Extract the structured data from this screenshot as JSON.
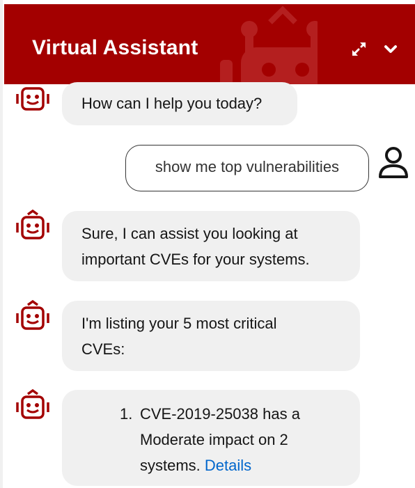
{
  "header": {
    "title": "Virtual Assistant",
    "icons": [
      "robot-icon",
      "expand-icon",
      "chevron-down-icon"
    ],
    "bg_color": "#a30000"
  },
  "messages": [
    {
      "sender": "bot",
      "lines": [
        "How can I help you today?"
      ]
    },
    {
      "sender": "user",
      "text": "show me top vulnerabilities"
    },
    {
      "sender": "bot",
      "lines": [
        "Sure, I can assist you looking at",
        "important CVEs for your systems."
      ]
    },
    {
      "sender": "bot",
      "lines": [
        "I'm listing your 5 most critical",
        "CVEs:"
      ]
    },
    {
      "sender": "bot",
      "list_number": "1.",
      "lines": [
        "CVE-2019-25038 has a",
        "Moderate impact on 2",
        "systems."
      ],
      "link": "Details"
    }
  ],
  "colors": {
    "bot_accent": "#a30000",
    "link": "#0066cc",
    "bubble_bg": "#f0f0f0"
  }
}
